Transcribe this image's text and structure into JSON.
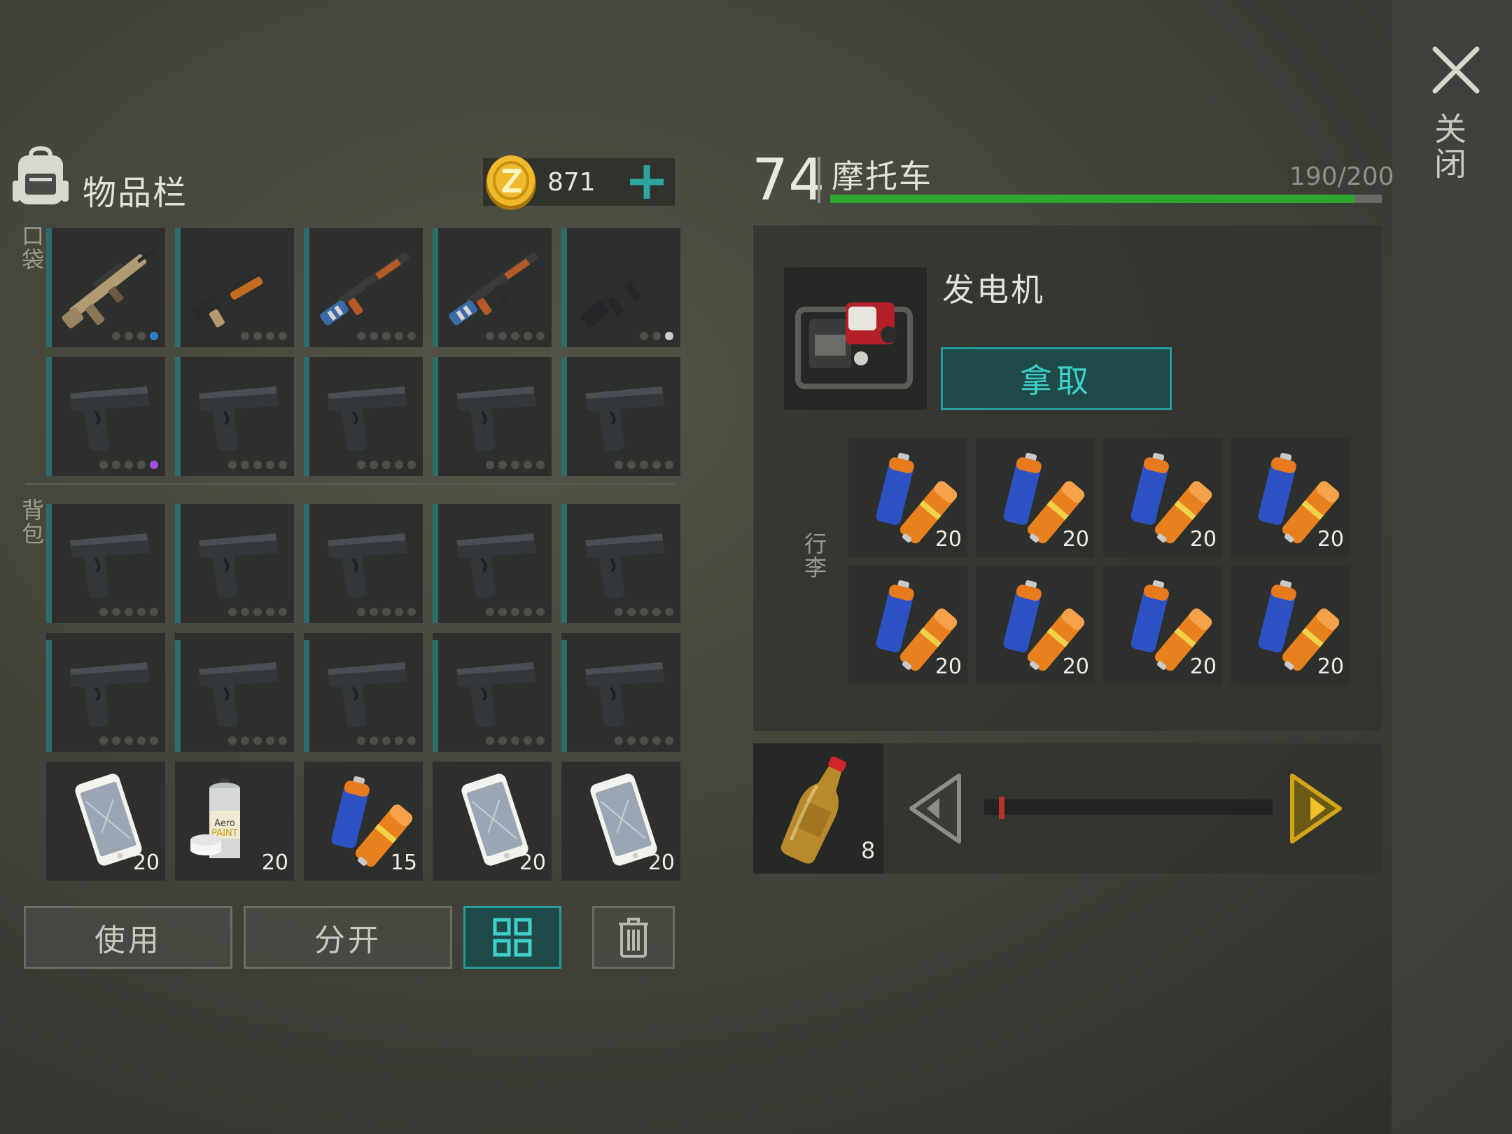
{
  "close": {
    "label": "关闭"
  },
  "inventory": {
    "title": "物品栏",
    "coins": "871",
    "pocket_label": "口袋",
    "bag_label": "背包",
    "slots": [
      {
        "item": "scar-rifle",
        "count": "",
        "rarity": "#2f7fd0"
      },
      {
        "item": "shotgun",
        "count": "",
        "rarity": ""
      },
      {
        "item": "ak47-blue",
        "count": "",
        "rarity": ""
      },
      {
        "item": "ak47-blue",
        "count": "",
        "rarity": ""
      },
      {
        "item": "m16-rifle",
        "count": "",
        "rarity": "#cccccc"
      },
      {
        "item": "pistol",
        "count": "",
        "rarity": "#a64ee0"
      },
      {
        "item": "pistol",
        "count": "",
        "rarity": ""
      },
      {
        "item": "pistol",
        "count": "",
        "rarity": ""
      },
      {
        "item": "pistol",
        "count": "",
        "rarity": ""
      },
      {
        "item": "pistol",
        "count": "",
        "rarity": ""
      },
      {
        "item": "pistol",
        "count": "",
        "rarity": ""
      },
      {
        "item": "pistol",
        "count": "",
        "rarity": ""
      },
      {
        "item": "pistol",
        "count": "",
        "rarity": ""
      },
      {
        "item": "pistol",
        "count": "",
        "rarity": ""
      },
      {
        "item": "pistol",
        "count": "",
        "rarity": ""
      },
      {
        "item": "pistol",
        "count": "",
        "rarity": ""
      },
      {
        "item": "pistol",
        "count": "",
        "rarity": ""
      },
      {
        "item": "pistol",
        "count": "",
        "rarity": ""
      },
      {
        "item": "pistol",
        "count": "",
        "rarity": ""
      },
      {
        "item": "pistol",
        "count": "",
        "rarity": ""
      },
      {
        "item": "smartphone",
        "count": "20",
        "rarity": ""
      },
      {
        "item": "spray-paint",
        "count": "20",
        "rarity": ""
      },
      {
        "item": "battery",
        "count": "15",
        "rarity": ""
      },
      {
        "item": "smartphone",
        "count": "20",
        "rarity": ""
      },
      {
        "item": "smartphone",
        "count": "20",
        "rarity": ""
      }
    ]
  },
  "buttons": {
    "use": "使用",
    "split": "分开"
  },
  "vehicle": {
    "level": "74",
    "name": "摩托车",
    "capacity": "190/200",
    "capacity_fraction": 0.95,
    "item_title": "发电机",
    "take_label": "拿取",
    "luggage_label": "行李",
    "cargo": [
      "20",
      "20",
      "20",
      "20",
      "20",
      "20",
      "20",
      "20"
    ],
    "fuel_count": "8",
    "fuel_slider_fraction": 0.05
  },
  "colors": {
    "accent_teal": "#2a9b98",
    "capacity_green": "#2fa42f",
    "arrow_gold": "#d4a418"
  }
}
